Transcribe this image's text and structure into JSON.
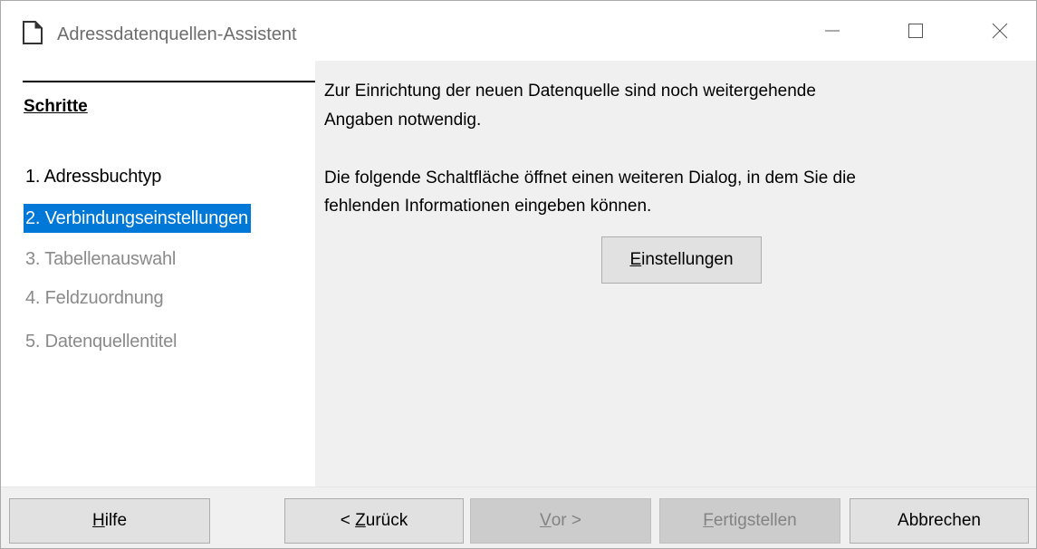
{
  "window": {
    "title": "Adressdatenquellen-Assistent",
    "icon": "document-icon"
  },
  "roadmap": {
    "title": "Schritte",
    "steps": [
      {
        "label": "1. Adressbuchtyp",
        "state": "normal"
      },
      {
        "label": "2. Verbindungseinstellungen",
        "state": "active"
      },
      {
        "label": "3. Tabellenauswahl",
        "state": "disabled"
      },
      {
        "label": "4. Feldzuordnung",
        "state": "disabled"
      },
      {
        "label": "5. Datenquellentitel",
        "state": "disabled"
      }
    ]
  },
  "content": {
    "line1": "Zur Einrichtung der neuen Datenquelle sind noch weitergehende",
    "line2": "Angaben notwendig.",
    "line3": "Die folgende Schaltfläche öffnet einen weiteren Dialog, in dem Sie die",
    "line4": "fehlenden Informationen eingeben können.",
    "settings_button": {
      "mnemonic": "E",
      "rest": "instellungen"
    }
  },
  "buttons": {
    "help": {
      "mnemonic": "H",
      "rest": "ilfe"
    },
    "back": {
      "prefix": "< ",
      "mnemonic": "Z",
      "rest": "urück"
    },
    "next": {
      "mnemonic": "V",
      "rest": "or >"
    },
    "finish": {
      "mnemonic": "F",
      "rest": "ertigstellen"
    },
    "cancel": {
      "label": "Abbrechen"
    }
  },
  "colors": {
    "highlight": "#0078d7",
    "disabled_text": "#8a8a8a"
  }
}
